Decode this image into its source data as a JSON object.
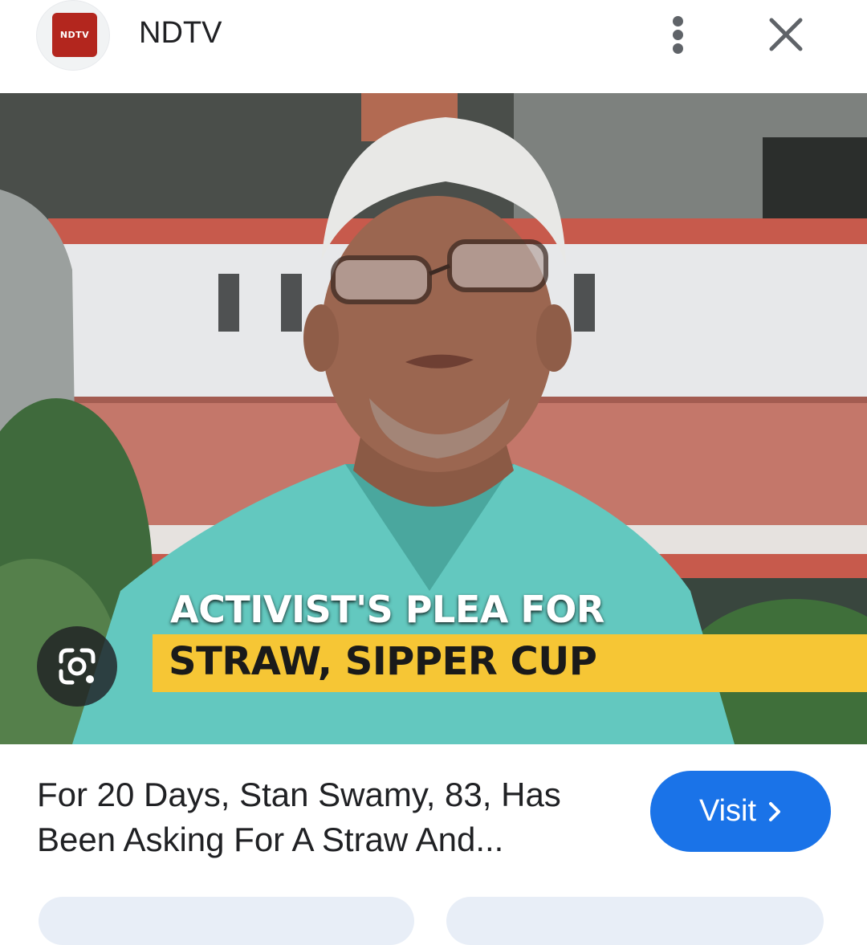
{
  "header": {
    "logo_text": "NDTV",
    "site_name": "NDTV",
    "more_icon": "more-vert-icon",
    "close_icon": "close-icon"
  },
  "image": {
    "caption_line1": "ACTIVIST'S PLEA FOR",
    "caption_line2": "STRAW, SIPPER CUP",
    "lens_icon": "google-lens-icon"
  },
  "result": {
    "title": "For 20 Days, Stan Swamy, 83, Has Been Asking For A Straw And...",
    "visit_label": "Visit",
    "visit_icon": "chevron-right-icon"
  },
  "colors": {
    "accent": "#1a73e8",
    "logo_red": "#b3261e",
    "banner_yellow": "#f6c635"
  }
}
